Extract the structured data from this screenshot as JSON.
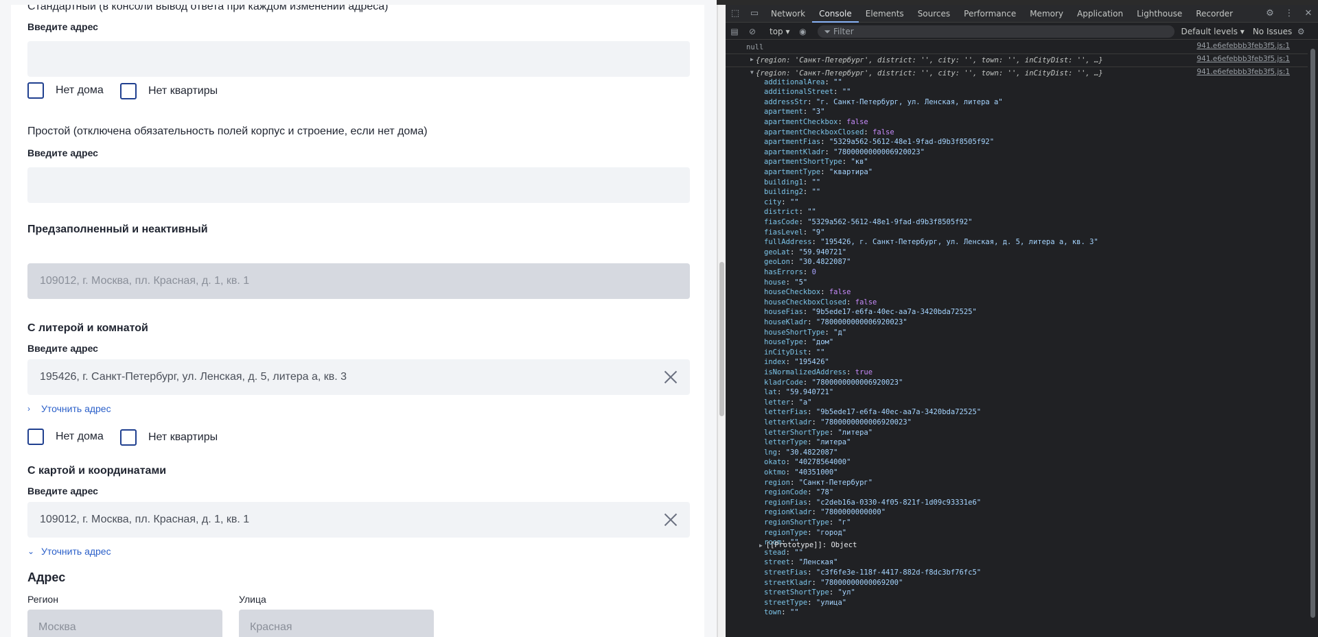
{
  "app": {
    "sections": {
      "standard_title": "Стандартный (в консоли вывод ответа при каждом изменении адреса)",
      "standard_label": "Введите адрес",
      "simple_title": "Простой (отключена обязательность полей корпус и строение, если нет дома)",
      "simple_label": "Введите адрес",
      "prefilled_title": "Предзаполненный и неактивный",
      "prefilled_value": "109012, г. Москва, пл. Красная, д. 1, кв. 1",
      "litera_title": "С литерой и комнатой",
      "litera_label": "Введите адрес",
      "litera_value": "195426, г. Санкт-Петербург, ул. Ленская, д. 5, литера а, кв. 3",
      "litera_link": "Уточнить адрес",
      "map_title": "С картой и координатами",
      "map_label": "Введите адрес",
      "map_value": "109012, г. Москва, пл. Красная, д. 1, кв. 1",
      "map_link": "Уточнить адрес",
      "address_heading": "Адрес",
      "region_label": "Регион",
      "region_value": "Москва",
      "street_label": "Улица",
      "street_value": "Красная"
    },
    "checkboxes": {
      "no_house": "Нет дома",
      "no_apartment": "Нет квартиры"
    }
  },
  "devtools": {
    "tabs": [
      "Network",
      "Console",
      "Elements",
      "Sources",
      "Performance",
      "Memory",
      "Application",
      "Lighthouse",
      "Recorder"
    ],
    "active_tab": "Console",
    "context": "top",
    "filter_placeholder": "Filter",
    "levels": "Default levels",
    "issues": "No Issues",
    "source": "941.e6efebbb3feb3f5.js:1",
    "null_line": "null",
    "collapsed_line": "{region: 'Санкт-Петербург', district: '', city: '', town: '', inCityDist: '', …}",
    "expanded_line": "{region: 'Санкт-Петербург', district: '', city: '', town: '', inCityDist: '', …}",
    "props": [
      [
        "additionalArea",
        "\"\"",
        "s"
      ],
      [
        "additionalStreet",
        "\"\"",
        "s"
      ],
      [
        "addressStr",
        "\"г. Санкт-Петербург, ул. Ленская, литера а\"",
        "s"
      ],
      [
        "apartment",
        "\"3\"",
        "s"
      ],
      [
        "apartmentCheckbox",
        "false",
        "b"
      ],
      [
        "apartmentCheckboxClosed",
        "false",
        "b"
      ],
      [
        "apartmentFias",
        "\"5329a562-5612-48e1-9fad-d9b3f8505f92\"",
        "s"
      ],
      [
        "apartmentKladr",
        "\"7800000000006920023\"",
        "s"
      ],
      [
        "apartmentShortType",
        "\"кв\"",
        "s"
      ],
      [
        "apartmentType",
        "\"квартира\"",
        "s"
      ],
      [
        "building1",
        "\"\"",
        "s"
      ],
      [
        "building2",
        "\"\"",
        "s"
      ],
      [
        "city",
        "\"\"",
        "s"
      ],
      [
        "district",
        "\"\"",
        "s"
      ],
      [
        "fiasCode",
        "\"5329a562-5612-48e1-9fad-d9b3f8505f92\"",
        "s"
      ],
      [
        "fiasLevel",
        "\"9\"",
        "s"
      ],
      [
        "fullAddress",
        "\"195426, г. Санкт-Петербург, ул. Ленская, д. 5, литера а, кв. 3\"",
        "s"
      ],
      [
        "geoLat",
        "\"59.940721\"",
        "s"
      ],
      [
        "geoLon",
        "\"30.4822087\"",
        "s"
      ],
      [
        "hasErrors",
        "0",
        "n"
      ],
      [
        "house",
        "\"5\"",
        "s"
      ],
      [
        "houseCheckbox",
        "false",
        "b"
      ],
      [
        "houseCheckboxClosed",
        "false",
        "b"
      ],
      [
        "houseFias",
        "\"9b5ede17-e6fa-40ec-aa7a-3420bda72525\"",
        "s"
      ],
      [
        "houseKladr",
        "\"7800000000006920023\"",
        "s"
      ],
      [
        "houseShortType",
        "\"д\"",
        "s"
      ],
      [
        "houseType",
        "\"дом\"",
        "s"
      ],
      [
        "inCityDist",
        "\"\"",
        "s"
      ],
      [
        "index",
        "\"195426\"",
        "s"
      ],
      [
        "isNormalizedAddress",
        "true",
        "b"
      ],
      [
        "kladrCode",
        "\"7800000000006920023\"",
        "s"
      ],
      [
        "lat",
        "\"59.940721\"",
        "s"
      ],
      [
        "letter",
        "\"а\"",
        "s"
      ],
      [
        "letterFias",
        "\"9b5ede17-e6fa-40ec-aa7a-3420bda72525\"",
        "s"
      ],
      [
        "letterKladr",
        "\"7800000000006920023\"",
        "s"
      ],
      [
        "letterShortType",
        "\"литера\"",
        "s"
      ],
      [
        "letterType",
        "\"литера\"",
        "s"
      ],
      [
        "lng",
        "\"30.4822087\"",
        "s"
      ],
      [
        "okato",
        "\"40278564000\"",
        "s"
      ],
      [
        "oktmo",
        "\"40351000\"",
        "s"
      ],
      [
        "region",
        "\"Санкт-Петербург\"",
        "s"
      ],
      [
        "regionCode",
        "\"78\"",
        "s"
      ],
      [
        "regionFias",
        "\"c2deb16a-0330-4f05-821f-1d09c93331e6\"",
        "s"
      ],
      [
        "regionKladr",
        "\"7800000000000\"",
        "s"
      ],
      [
        "regionShortType",
        "\"г\"",
        "s"
      ],
      [
        "regionType",
        "\"город\"",
        "s"
      ],
      [
        "room",
        "\"\"",
        "s"
      ],
      [
        "stead",
        "\"\"",
        "s"
      ],
      [
        "street",
        "\"Ленская\"",
        "s"
      ],
      [
        "streetFias",
        "\"c3f6fe3e-118f-4417-882d-f8dc3bf76fc5\"",
        "s"
      ],
      [
        "streetKladr",
        "\"78000000000069200\"",
        "s"
      ],
      [
        "streetShortType",
        "\"ул\"",
        "s"
      ],
      [
        "streetType",
        "\"улица\"",
        "s"
      ],
      [
        "town",
        "\"\"",
        "s"
      ]
    ],
    "prototype": "[[Prototype]]: Object",
    "colors": {
      "accent": "#8ab4f8",
      "link": "#2a5fc9",
      "checkbox": "#1f3f8f"
    },
    "icons": [
      "inspect-icon",
      "device-icon",
      "clear-icon",
      "eye-icon",
      "filter-icon",
      "gear-icon",
      "more-icon",
      "close-icon"
    ]
  }
}
